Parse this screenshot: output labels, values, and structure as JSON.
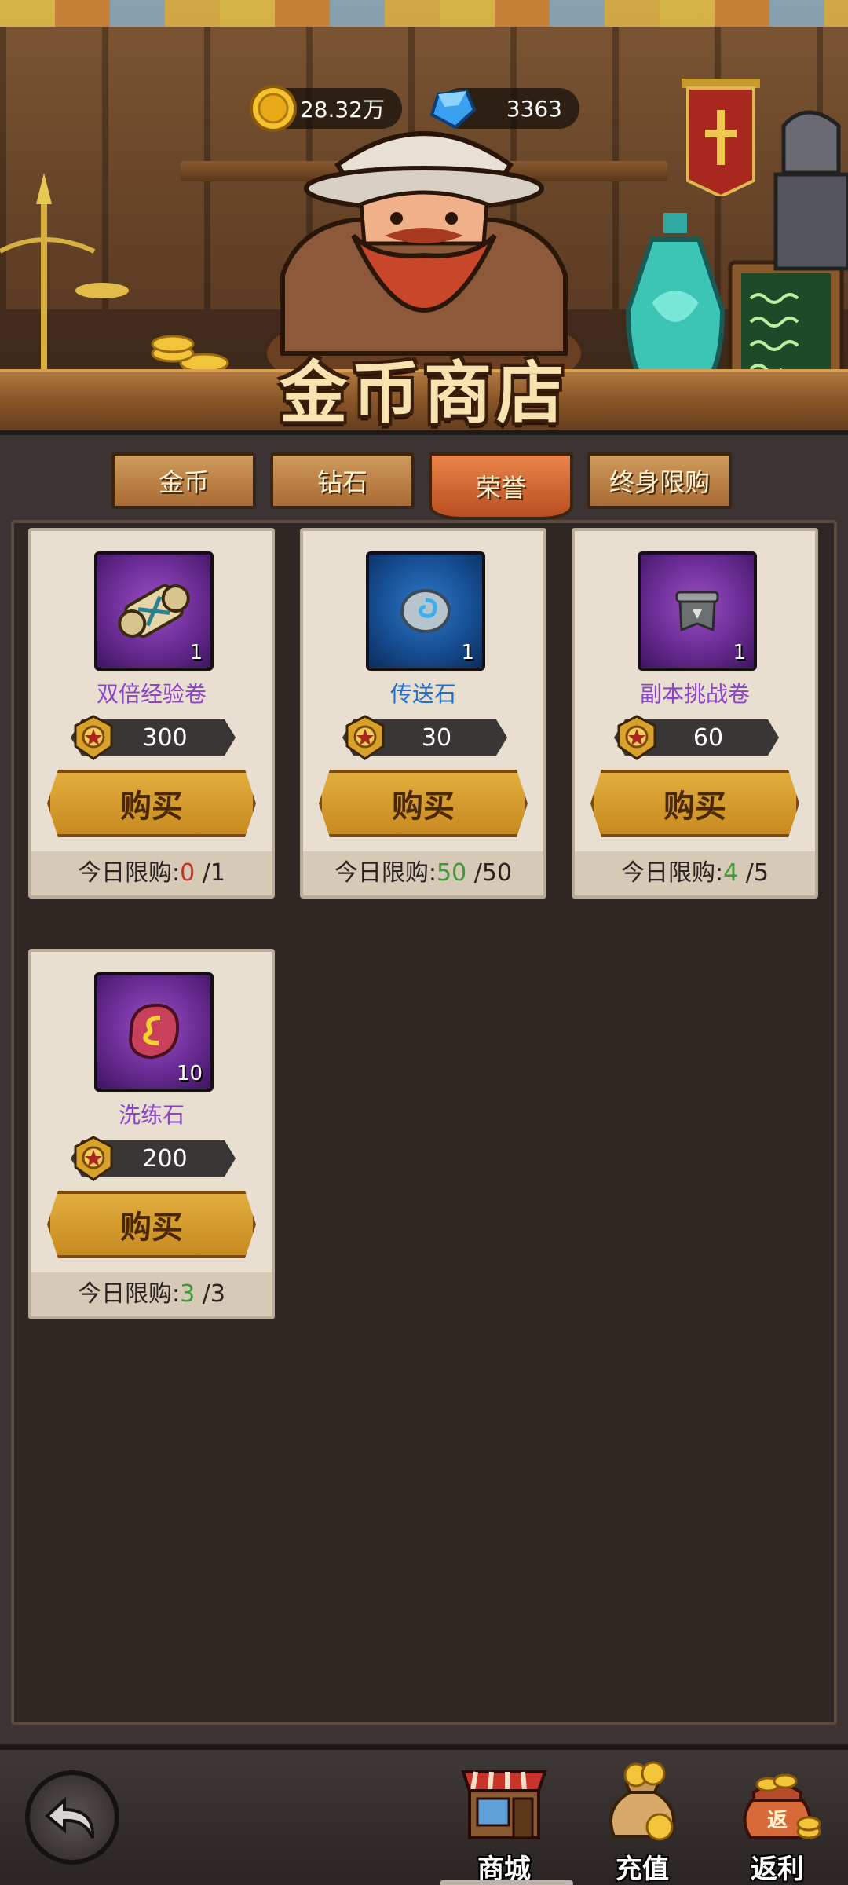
{
  "currency": {
    "gold": "28.32万",
    "diamond": "3363"
  },
  "shop": {
    "title": "金币商店"
  },
  "tabs": [
    {
      "label": "金币"
    },
    {
      "label": "钻石"
    },
    {
      "label": "荣誉"
    },
    {
      "label": "终身限购"
    }
  ],
  "items": [
    {
      "name": "双倍经验卷",
      "count": "1",
      "price": "300",
      "buy_label": "购买",
      "limit_label": "今日限购:",
      "bought": "0",
      "limit_total": "/1"
    },
    {
      "name": "传送石",
      "count": "1",
      "price": "30",
      "buy_label": "购买",
      "limit_label": "今日限购:",
      "bought": "50",
      "limit_total": "/50"
    },
    {
      "name": "副本挑战卷",
      "count": "1",
      "price": "60",
      "buy_label": "购买",
      "limit_label": "今日限购:",
      "bought": "4",
      "limit_total": "/5"
    },
    {
      "name": "洗练石",
      "count": "10",
      "price": "200",
      "buy_label": "购买",
      "limit_label": "今日限购:",
      "bought": "3",
      "limit_total": "/3"
    }
  ],
  "nav": {
    "shop": "商城",
    "recharge": "充值",
    "rebate": "返利",
    "rebate_badge": "返"
  },
  "icons": {
    "back": "back-arrow-icon",
    "gold": "gold-coin-icon",
    "diamond": "blue-diamond-icon",
    "honor": "honor-medal-icon"
  },
  "colors": {
    "active_tab": "#d8703a",
    "buy_button": "#d49a30",
    "limit_reached": "#c83222",
    "limit_available": "#3a9a3a"
  },
  "active_tab": "荣誉"
}
